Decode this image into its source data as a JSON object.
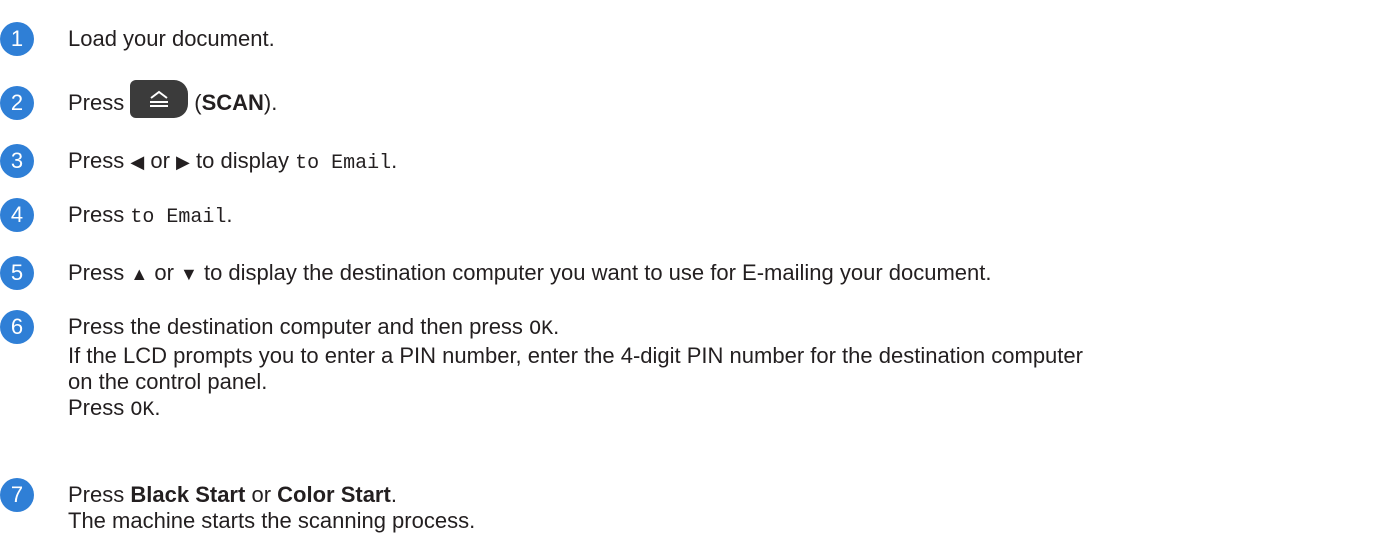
{
  "steps": [
    {
      "num": "1",
      "parts": [
        "Load your document."
      ]
    },
    {
      "num": "2",
      "press": "Press",
      "paren_open": "(",
      "button_label": "SCAN",
      "paren_close": ").",
      "icon": "scan-icon"
    },
    {
      "num": "3",
      "press": "Press",
      "left_arrow": "◀",
      "or": "or",
      "right_arrow": "▶",
      "to_display": "to display",
      "mono": "to Email",
      "end": "."
    },
    {
      "num": "4",
      "press": "Press",
      "mono": "to Email",
      "end": "."
    },
    {
      "num": "5",
      "press": "Press",
      "up_arrow": "▲",
      "or": "or",
      "down_arrow": "▼",
      "rest": "to display the destination computer you want to use for E-mailing your document."
    },
    {
      "num": "6",
      "line1_pre": "Press the destination computer and then press",
      "line1_mono": "OK",
      "line1_end": ".",
      "line2": "If the LCD prompts you to enter a PIN number, enter the 4-digit PIN number for the destination computer",
      "line3": "on the control panel.",
      "line4_pre": "Press",
      "line4_mono": "OK",
      "line4_end": "."
    },
    {
      "num": "7",
      "press": "Press",
      "bold1": "Black Start",
      "or": "or",
      "bold2": "Color Start",
      "end": ".",
      "line2": "The machine starts the scanning process."
    }
  ],
  "colors": {
    "badge": "#2f7fd6",
    "text": "#231f20",
    "button": "#3b3b3b"
  }
}
